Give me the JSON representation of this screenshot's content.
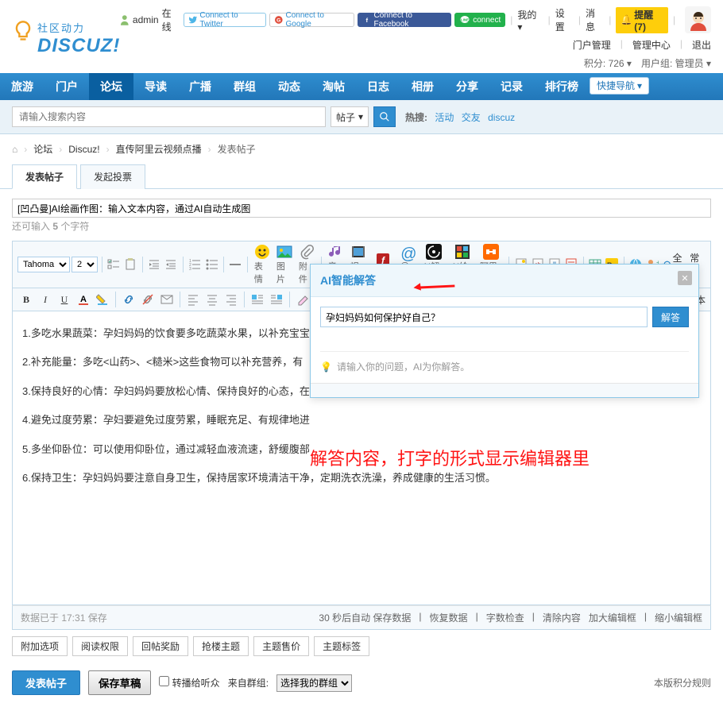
{
  "logo": {
    "cn": "社区动力",
    "en": "DISCUZ!"
  },
  "topbar": {
    "user": "admin",
    "online": "在线",
    "connect": {
      "twitter": "Connect to Twitter",
      "google": "Connect to Google",
      "facebook": "Connect to Facebook",
      "line": "connect"
    },
    "my": "我的",
    "settings": "设置",
    "messages": "消息",
    "reminder": "提醒(7)",
    "portal_admin": "门户管理",
    "admin_center": "管理中心",
    "logout": "退出",
    "points_label": "积分: ",
    "points_value": "726",
    "group_label": "用户组: ",
    "group_value": "管理员"
  },
  "nav": {
    "items": [
      "旅游",
      "门户",
      "论坛",
      "导读",
      "广播",
      "群组",
      "动态",
      "淘帖",
      "日志",
      "相册",
      "分享",
      "记录",
      "排行榜"
    ],
    "quick": "快捷导航"
  },
  "search": {
    "placeholder": "请输入搜索内容",
    "scope": "帖子",
    "hot_label": "热搜:",
    "hot_items": [
      "活动",
      "交友",
      "discuz"
    ]
  },
  "breadcrumb": [
    "论坛",
    "Discuz!",
    "直传阿里云视频点播",
    "发表帖子"
  ],
  "tabs": {
    "post": "发表帖子",
    "poll": "发起投票"
  },
  "subject": {
    "value": "[凹凸曼]AI绘画作图：输入文本内容，通过AI自动生成图",
    "char_prefix": "还可输入 ",
    "char_count": "5",
    "char_suffix": " 个字符"
  },
  "toolbar": {
    "font_family": "Tahoma",
    "font_size": "2",
    "labels": {
      "emoji": "表情",
      "image": "图片",
      "attach": "附件",
      "music": "音乐",
      "video": "视频",
      "flash": "Flash",
      "at": "@朋",
      "ai_answer": "AI解答",
      "ai_paint": "AI绘画",
      "aliyun": "阿里云"
    },
    "arrow": "↶",
    "fullscreen": "全屏",
    "normal": "常用",
    "plain": "纯文本"
  },
  "editor_content": [
    "1.多吃水果蔬菜：孕妇妈妈的饮食要多吃蔬菜水果，以补充宝宝",
    "2.补充能量：多吃<山药>、<糙米>这些食物可以补充营养，有",
    "3.保持良好的心情：孕妇妈妈要放松心情、保持良好的心态，在",
    "4.避免过度劳累：孕妇要避免过度劳累，睡眠充足、有规律地进",
    "5.多坐仰卧位：可以使用仰卧位，通过减轻血液流速，舒缓腹部",
    "6.保持卫生：孕妇妈妈要注意自身卫生，保持居家环境清洁干净，定期洗衣洗澡，养成健康的生活习惯。"
  ],
  "ai_popup": {
    "title": "AI智能解答",
    "input_value": "孕妇妈妈如何保护好自己？",
    "answer_btn": "解答",
    "hint": "请输入你的问题，AI为你解答。"
  },
  "red_annotation": "解答内容，打字的形式显示编辑器里",
  "editor_footer": {
    "save_status": "数据已于 17:31 保存",
    "autosave": "30 秒后自动 保存数据",
    "restore": "恢复数据",
    "wordcheck": "字数检查",
    "clear": "清除内容",
    "enlarge": "加大编辑框",
    "shrink": "缩小编辑框"
  },
  "options": [
    "附加选项",
    "阅读权限",
    "回帖奖励",
    "抢楼主题",
    "主题售价",
    "主题标签"
  ],
  "submit": {
    "publish": "发表帖子",
    "draft": "保存草稿",
    "repost": "转播给听众",
    "from_group_label": "来自群组:",
    "from_group_value": "选择我的群组",
    "rules": "本版积分规则"
  }
}
